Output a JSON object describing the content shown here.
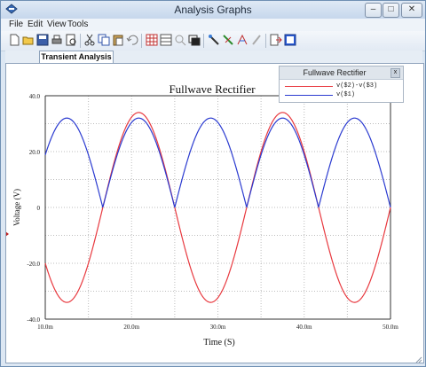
{
  "window": {
    "title": "Analysis Graphs"
  },
  "menu": [
    "File",
    "Edit",
    "View",
    "Tools"
  ],
  "tab": {
    "label": "Transient Analysis"
  },
  "legend": {
    "title": "Fullwave Rectifier",
    "close": "x",
    "items": [
      {
        "label": "v($2)-v($3)",
        "color": "#e8393f"
      },
      {
        "label": "v($1)",
        "color": "#2b3bd0"
      }
    ]
  },
  "colors": {
    "red": "#e8393f",
    "blue": "#2b3bd0"
  },
  "chart_data": {
    "type": "line",
    "title": "Fullwave Rectifier",
    "xlabel": "Time (S)",
    "ylabel": "Voltage (V)",
    "xlim": [
      10.0,
      50.0
    ],
    "ylim": [
      -40.0,
      40.0
    ],
    "x_ticks": [
      "10.0m",
      "20.0m",
      "30.0m",
      "40.0m",
      "50.0m"
    ],
    "y_ticks": [
      "40.0",
      "20.0",
      "0",
      "-20.0",
      "-40.0"
    ],
    "grid": true,
    "series": [
      {
        "name": "v($2)-v($3)",
        "description": "sine, amplitude 34, period 16.67 ms",
        "x": [
          10.0,
          12.08,
          14.17,
          16.25,
          18.33,
          20.42,
          22.5,
          24.58,
          26.67,
          28.75,
          30.83,
          32.92,
          35.0,
          37.08,
          39.17,
          41.25,
          43.33,
          45.42,
          47.5,
          49.58,
          50.0
        ],
        "y": [
          -20.0,
          -32.4,
          -32.4,
          -20.0,
          0.0,
          20.0,
          32.4,
          32.4,
          20.0,
          0.0,
          -20.0,
          -32.4,
          -32.4,
          -20.0,
          0.0,
          20.0,
          32.4,
          32.4,
          20.0,
          0.0,
          -2.0
        ]
      },
      {
        "name": "v($1)",
        "description": "full-wave rectified sine, peak 32",
        "x": [
          10.0,
          12.08,
          14.17,
          16.25,
          18.33,
          20.42,
          22.5,
          24.58,
          26.67,
          28.75,
          30.83,
          32.92,
          35.0,
          37.08,
          39.17,
          41.25,
          43.33,
          45.42,
          47.5,
          49.58,
          50.0
        ],
        "y": [
          19.0,
          30.4,
          30.4,
          19.0,
          0.0,
          19.0,
          30.4,
          30.4,
          19.0,
          0.0,
          19.0,
          30.4,
          30.4,
          19.0,
          0.0,
          19.0,
          30.4,
          30.4,
          19.0,
          0.0,
          0.0
        ]
      }
    ]
  }
}
